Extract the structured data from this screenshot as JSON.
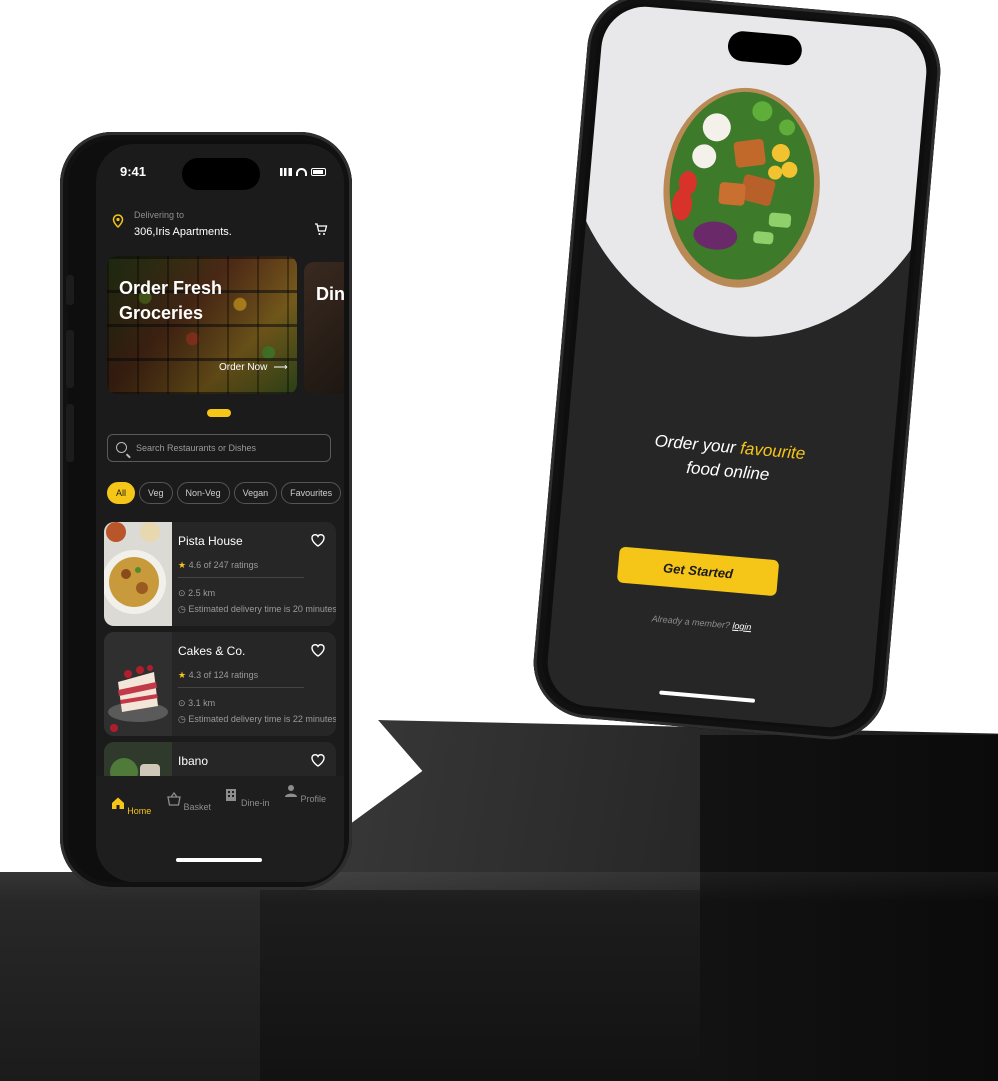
{
  "status_bar": {
    "time": "9:41"
  },
  "location": {
    "label": "Delivering to",
    "address": "306,Iris Apartments."
  },
  "banners": [
    {
      "title": "Order Fresh Groceries",
      "action": "Order Now"
    },
    {
      "title": "Din rest"
    }
  ],
  "search": {
    "placeholder": "Search Restaurants or Dishes"
  },
  "filters": [
    "All",
    "Veg",
    "Non-Veg",
    "Vegan",
    "Favourites"
  ],
  "restaurants": [
    {
      "name": "Pista House",
      "rating": "4.6 of 247 ratings",
      "distance": "2.5 km",
      "eta": "Estimated delivery time is 20 minutes"
    },
    {
      "name": "Cakes & Co.",
      "rating": "4.3 of 124 ratings",
      "distance": "3.1 km",
      "eta": "Estimated delivery time is 22 minutes"
    },
    {
      "name": "Ibano"
    }
  ],
  "tabs": [
    {
      "label": "Home",
      "icon": "home-icon",
      "active": true
    },
    {
      "label": "Basket",
      "icon": "basket-icon"
    },
    {
      "label": "Dine-in",
      "icon": "building-icon"
    },
    {
      "label": "Profile",
      "icon": "person-icon"
    }
  ],
  "onboarding": {
    "headline_pre": "Order your",
    "headline_highlight": "favourite",
    "headline_post": "food online",
    "cta": "Get Started",
    "member_text": "Already a member?",
    "login": "login"
  },
  "colors": {
    "accent": "#f5c518",
    "background": "#1b1b1b"
  }
}
